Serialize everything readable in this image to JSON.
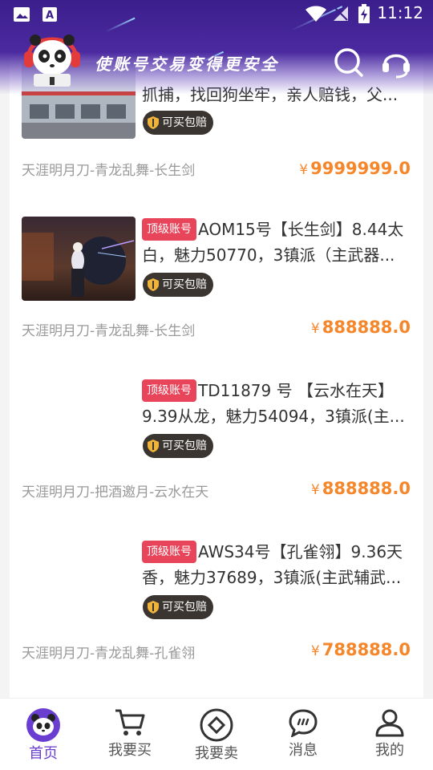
{
  "status_bar": {
    "time": "11:12"
  },
  "header": {
    "slogan": "使账号交易变得更安全"
  },
  "listings": [
    {
      "title_line1": "",
      "title_line2": "抓捕，找回狗坐牢，亲人赔钱，父...",
      "guarantee": "可买包赔",
      "category": "天涯明月刀-青龙乱舞-长生剑",
      "currency": "¥",
      "price": "9999999.0"
    },
    {
      "badge": "顶级账号",
      "title_line1": "AOM15号【长生剑】8.44太",
      "title_line2": "白，魅力50770，3镇派（主武器...",
      "guarantee": "可买包赔",
      "category": "天涯明月刀-青龙乱舞-长生剑",
      "currency": "¥",
      "price": "888888.0"
    },
    {
      "badge": "顶级账号",
      "title_line1": "TD11879 号 【云水在天】",
      "title_line2": "9.39从龙，魅力54094，3镇派(主...",
      "guarantee": "可买包赔",
      "category": "天涯明月刀-把酒邀月-云水在天",
      "currency": "¥",
      "price": "888888.0"
    },
    {
      "badge": "顶级账号",
      "title_line1": "AWS34号【孔雀翎】9.36天",
      "title_line2": "香，魅力37689，3镇派(主武辅武...",
      "guarantee": "可买包赔",
      "category": "天涯明月刀-青龙乱舞-孔雀翎",
      "currency": "¥",
      "price": "788888.0"
    }
  ],
  "nav": [
    {
      "label": "首页",
      "icon": "panda-home-icon",
      "active": true
    },
    {
      "label": "我要买",
      "icon": "cart-icon"
    },
    {
      "label": "我要卖",
      "icon": "sell-circle-icon"
    },
    {
      "label": "消息",
      "icon": "chat-bubble-icon"
    },
    {
      "label": "我的",
      "icon": "user-icon"
    }
  ],
  "colors": {
    "accent": "#6a3ed1",
    "price": "#f5862a",
    "badge": "#e8455b",
    "header": "#3b1e8c"
  }
}
